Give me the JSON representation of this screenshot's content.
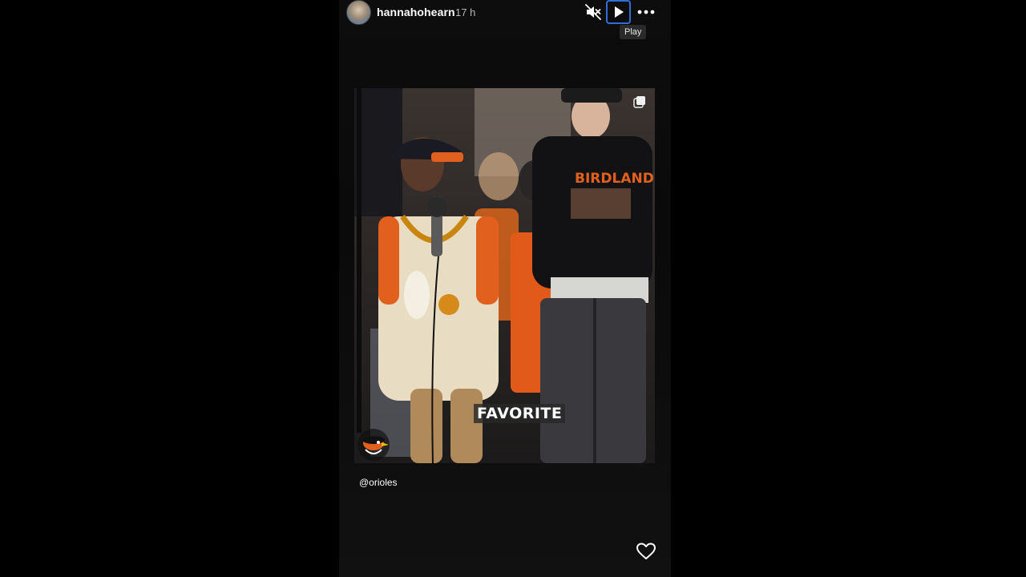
{
  "story": {
    "username": "hannahohearn",
    "time_ago": "17 h",
    "tooltip": "Play",
    "overlay_caption": "FAVORITE",
    "mention": "@orioles"
  },
  "icons": {
    "avatar": "profile-avatar",
    "mute": "speaker-muted-icon",
    "play": "play-icon",
    "more": "more-options-icon",
    "copy": "multiple-items-icon",
    "logo": "orioles-bird-logo",
    "like": "heart-icon"
  },
  "colors": {
    "background": "#000000",
    "focus_ring": "#2f6fd6",
    "orange": "#e2601d"
  }
}
